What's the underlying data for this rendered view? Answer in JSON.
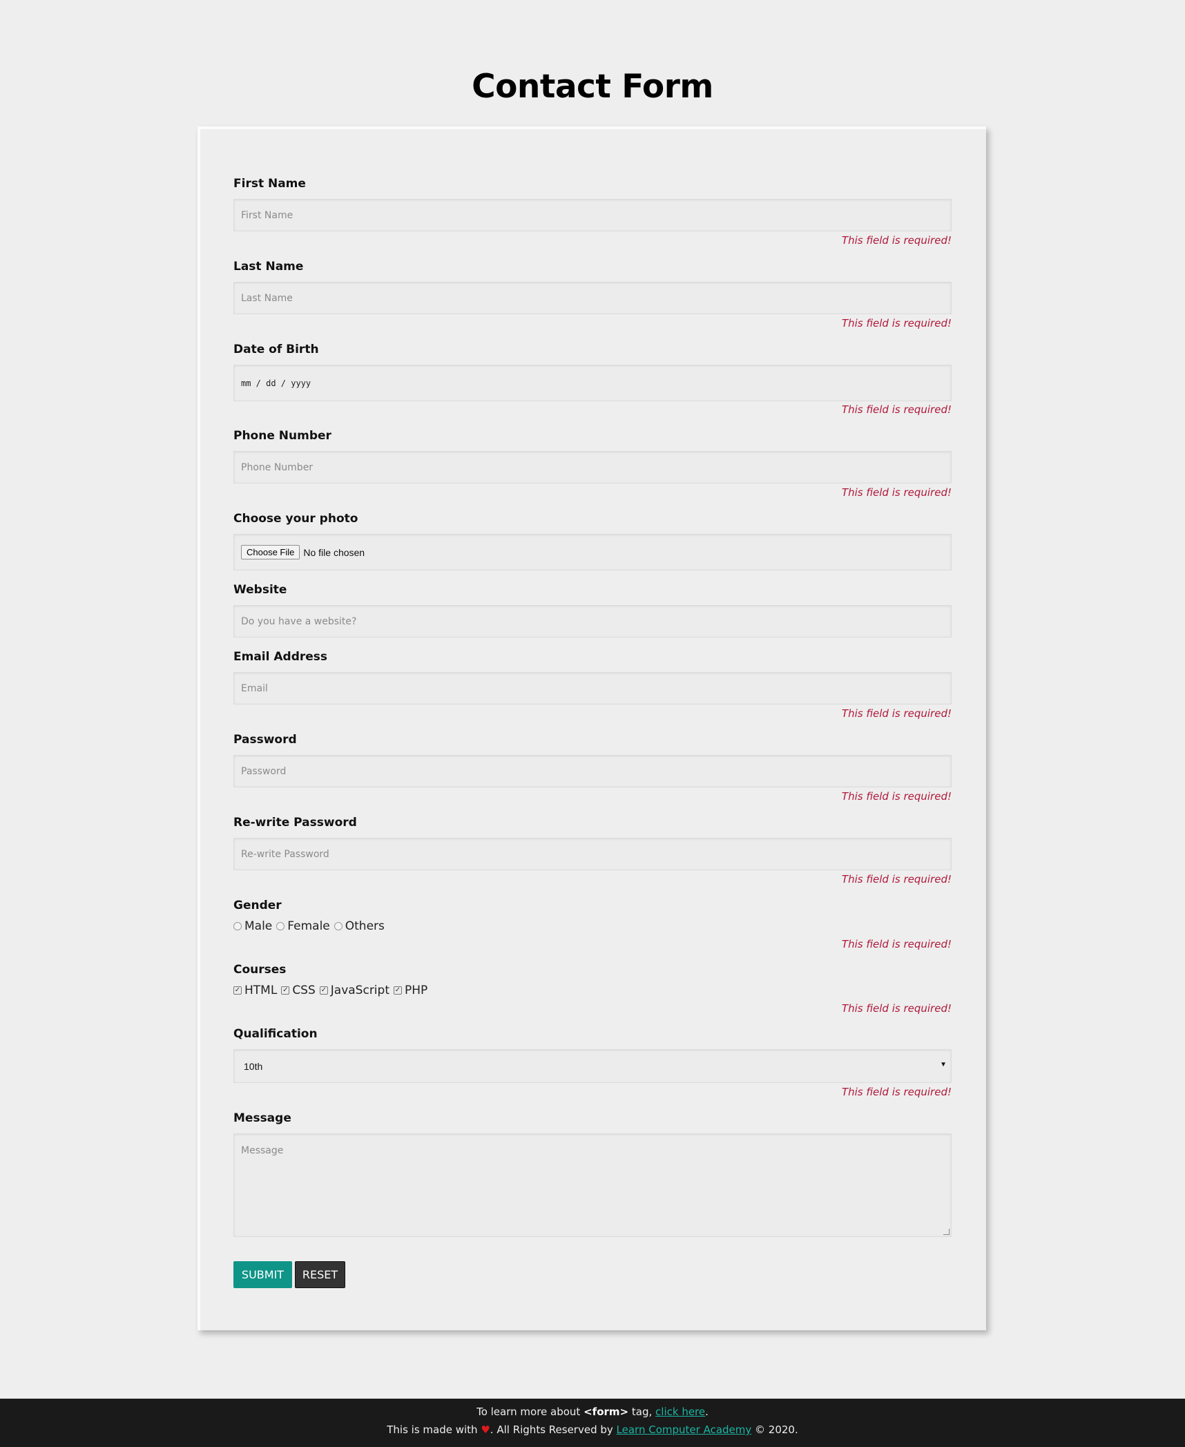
{
  "page": {
    "title": "Contact Form"
  },
  "form": {
    "required_msg": "This field is required!",
    "first_name": {
      "label": "First Name",
      "placeholder": "First Name"
    },
    "last_name": {
      "label": "Last Name",
      "placeholder": "Last Name"
    },
    "dob": {
      "label": "Date of Birth",
      "placeholder": "mm / dd / yyyy"
    },
    "phone": {
      "label": "Phone Number",
      "placeholder": "Phone Number"
    },
    "photo": {
      "label": "Choose your photo",
      "button": "Choose File",
      "status": "No file chosen"
    },
    "website": {
      "label": "Website",
      "placeholder": "Do you have a website?"
    },
    "email": {
      "label": "Email Address",
      "placeholder": "Email"
    },
    "password": {
      "label": "Password",
      "placeholder": "Password"
    },
    "repassword": {
      "label": "Re-write Password",
      "placeholder": "Re-write Password"
    },
    "gender": {
      "label": "Gender",
      "options": [
        "Male",
        "Female",
        "Others"
      ]
    },
    "courses": {
      "label": "Courses",
      "options": [
        "HTML",
        "CSS",
        "JavaScript",
        "PHP"
      ]
    },
    "qualification": {
      "label": "Qualification",
      "selected": "10th"
    },
    "message": {
      "label": "Message",
      "placeholder": "Message"
    },
    "submit": "SUBMIT",
    "reset": "RESET"
  },
  "footer": {
    "line1_prefix": "To learn more about",
    "line1_tag": "<form>",
    "line1_mid": "tag,",
    "line1_link": "click here",
    "line1_end": ".",
    "line2_prefix": "This is made with",
    "line2_heart": "♥",
    "line2_mid": ". All Rights Reserved by",
    "line2_link": "Learn Computer Academy",
    "line2_end": "© 2020."
  }
}
